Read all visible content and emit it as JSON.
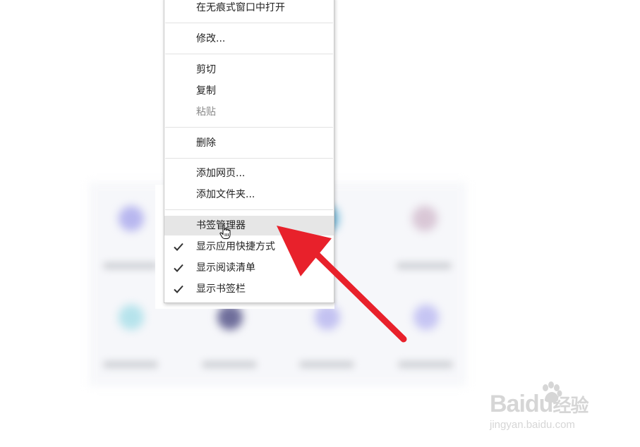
{
  "context_menu": {
    "items": [
      {
        "label": "在无痕式窗口中打开",
        "checked": false,
        "disabled": false
      },
      {
        "label": "修改...",
        "checked": false,
        "disabled": false
      },
      {
        "label": "剪切",
        "checked": false,
        "disabled": false
      },
      {
        "label": "复制",
        "checked": false,
        "disabled": false
      },
      {
        "label": "粘贴",
        "checked": false,
        "disabled": true
      },
      {
        "label": "删除",
        "checked": false,
        "disabled": false
      },
      {
        "label": "添加网页...",
        "checked": false,
        "disabled": false
      },
      {
        "label": "添加文件夹...",
        "checked": false,
        "disabled": false
      },
      {
        "label": "书签管理器",
        "checked": false,
        "disabled": false,
        "highlighted": true
      },
      {
        "label": "显示应用快捷方式",
        "checked": true,
        "disabled": false
      },
      {
        "label": "显示阅读清单",
        "checked": true,
        "disabled": false
      },
      {
        "label": "显示书签栏",
        "checked": true,
        "disabled": false
      }
    ]
  },
  "colors": {
    "highlight": "#e6e6e6",
    "annotation_arrow": "#e8212b",
    "disabled_text": "#8a8a8a"
  },
  "watermark": {
    "brand_text": "Baidu",
    "brand_suffix": "经验",
    "site": "jingyan.baidu.com"
  },
  "icons": {
    "check": "check-icon",
    "cursor": "hand-pointer-icon",
    "annotation": "red-arrow"
  }
}
